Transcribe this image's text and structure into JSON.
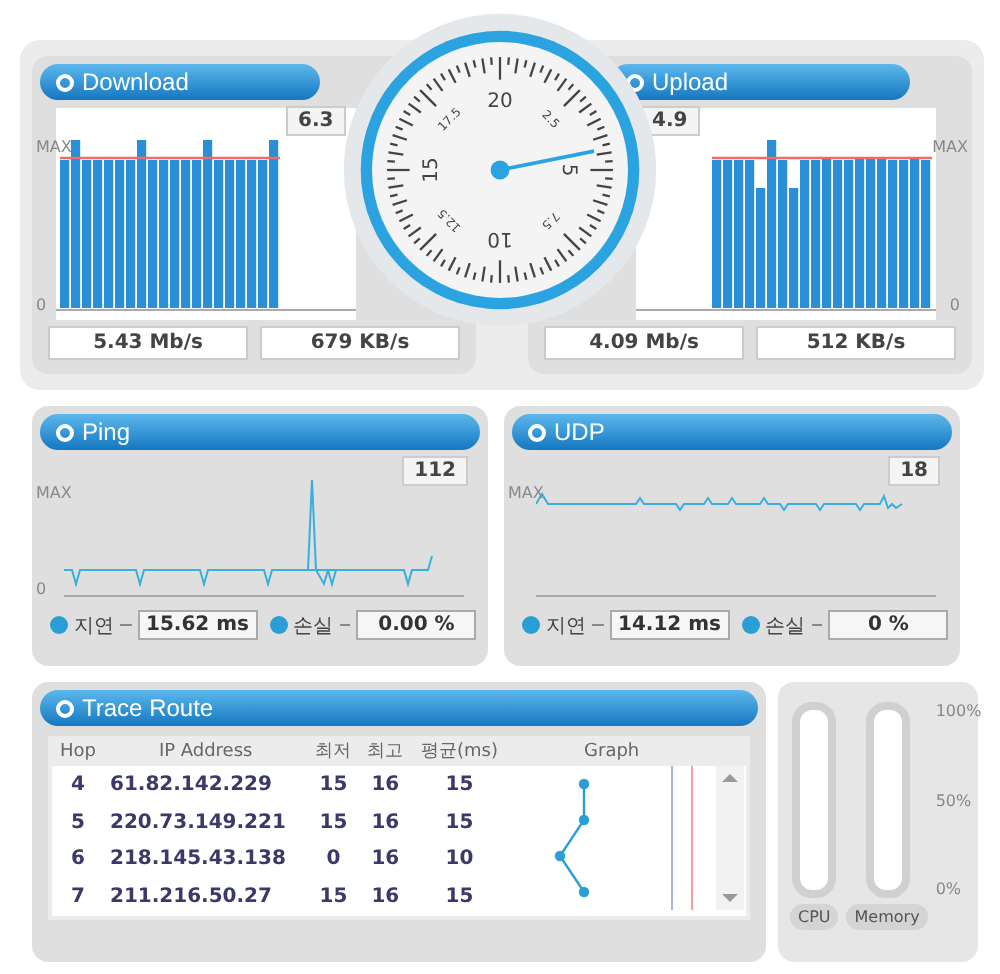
{
  "download": {
    "title": "Download",
    "max_label": "MAX",
    "zero_label": "0",
    "peak": "6.3",
    "readings": [
      "5.43 Mb/s",
      "679 KB/s"
    ]
  },
  "upload": {
    "title": "Upload",
    "max_label": "MAX",
    "zero_label": "0",
    "peak": "4.9",
    "readings": [
      "4.09 Mb/s",
      "512 KB/s"
    ]
  },
  "gauge": {
    "labels": [
      "20",
      "2.5",
      "5",
      "7.5",
      "10",
      "12.5",
      "15",
      "17.5"
    ]
  },
  "ping": {
    "title": "Ping",
    "max_label": "MAX",
    "zero_label": "0",
    "peak": "112",
    "stats": [
      {
        "label": "지연",
        "value": "15.62 ms"
      },
      {
        "label": "손실",
        "value": "0.00 %"
      }
    ]
  },
  "udp": {
    "title": "UDP",
    "max_label": "MAX",
    "peak": "18",
    "stats": [
      {
        "label": "지연",
        "value": "14.12 ms"
      },
      {
        "label": "손실",
        "value": "0 %"
      }
    ]
  },
  "trace": {
    "title": "Trace Route",
    "columns": [
      "Hop",
      "IP Address",
      "최저",
      "최고",
      "평균(ms)",
      "Graph"
    ],
    "rows": [
      [
        "4",
        "61.82.142.229",
        "15",
        "16",
        "15"
      ],
      [
        "5",
        "220.73.149.221",
        "15",
        "16",
        "15"
      ],
      [
        "6",
        "218.145.43.138",
        "0",
        "16",
        "10"
      ],
      [
        "7",
        "211.216.50.27",
        "15",
        "16",
        "15"
      ]
    ]
  },
  "system": {
    "meters": [
      {
        "name": "CPU",
        "level": 0
      },
      {
        "name": "Memory",
        "level": 0
      }
    ],
    "scale": [
      "100%",
      "50%",
      "0%"
    ]
  }
}
